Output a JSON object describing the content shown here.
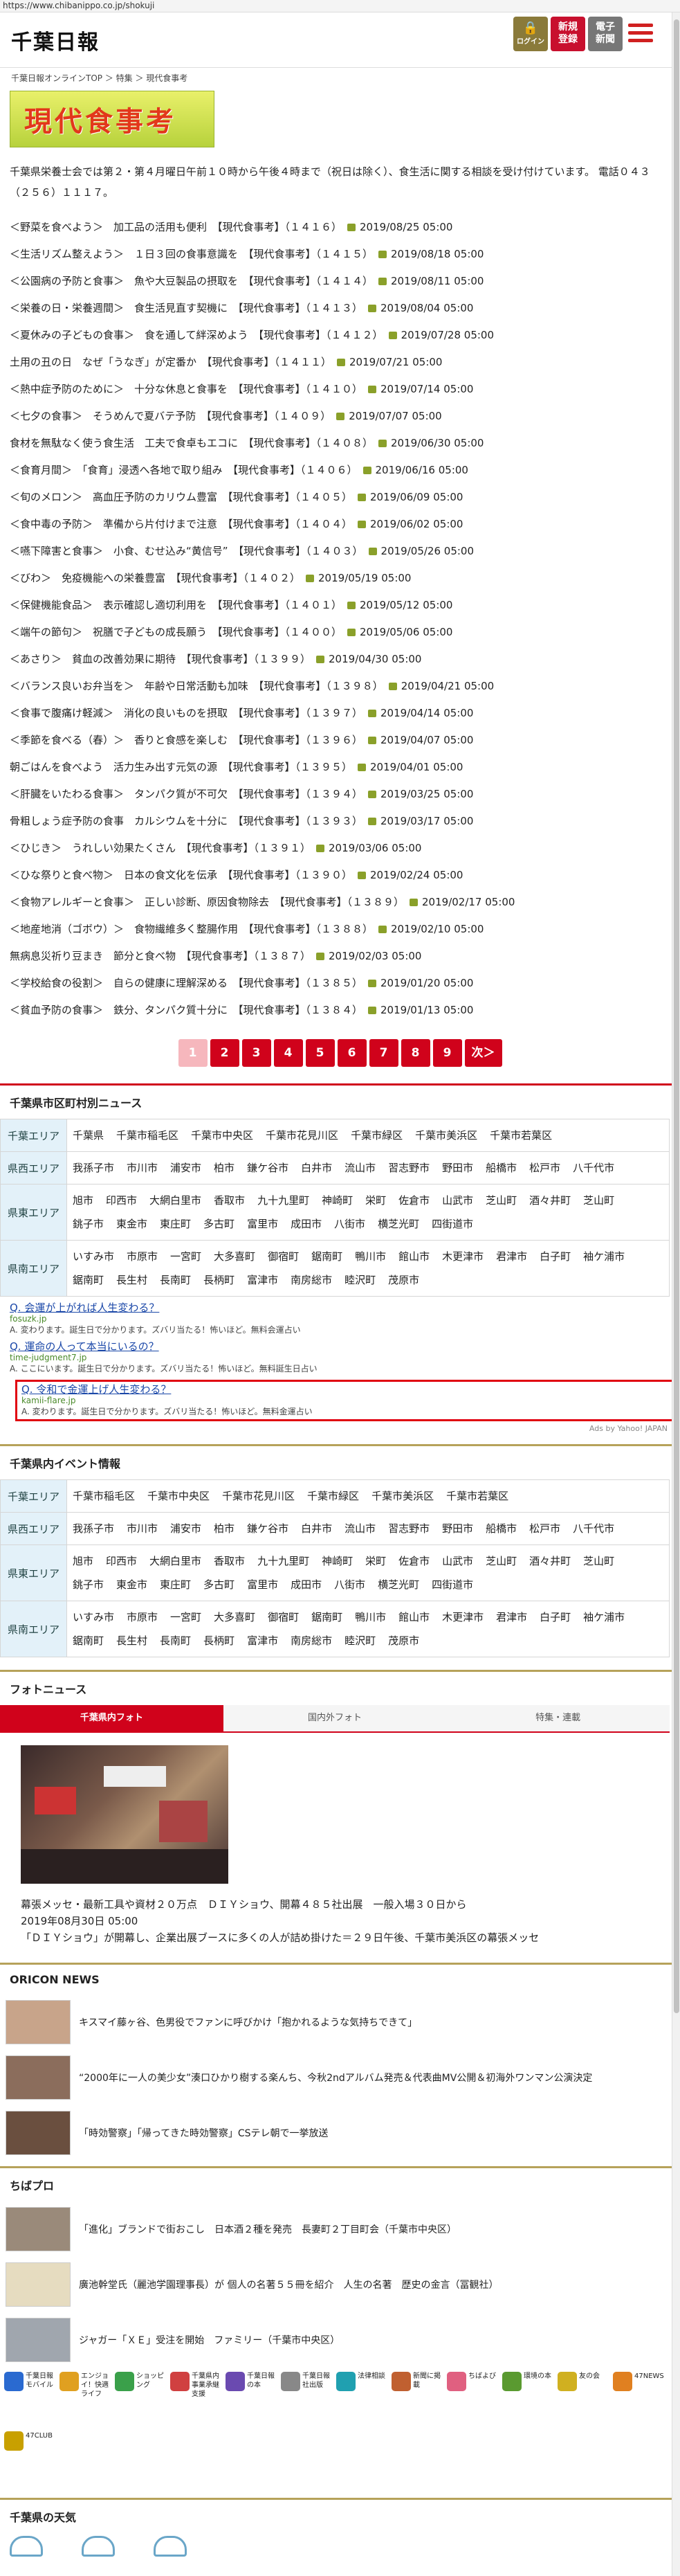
{
  "url": "https://www.chibanippo.co.jp/shokuji",
  "header": {
    "logo": "千葉日報",
    "login": "ログイン",
    "register1": "新規",
    "register2": "登録",
    "epaper1": "電子",
    "epaper2": "新聞"
  },
  "breadcrumb": "千葉日報オンラインTOP ＞ 特集 ＞ 現代食事考",
  "banner_title": "現代食事考",
  "intro": "千葉県栄養士会では第２・第４月曜日午前１０時から午後４時まで（祝日は除く）、食生活に関する相談を受け付けています。 電話０４３（２５６）１１１７。",
  "articles": [
    {
      "title": "＜野菜を食べよう＞　加工品の活用も便利　【現代食事考】（１４１６）",
      "date": "2019/08/25 05:00"
    },
    {
      "title": "＜生活リズム整えよう＞　１日３回の食事意識を　【現代食事考】（１４１５）",
      "date": "2019/08/18 05:00"
    },
    {
      "title": "＜公園病の予防と食事＞　魚や大豆製品の摂取を　【現代食事考】（１４１４）",
      "date": "2019/08/11 05:00"
    },
    {
      "title": "＜栄養の日・栄養週間＞　食生活見直す契機に　【現代食事考】（１４１３）",
      "date": "2019/08/04 05:00"
    },
    {
      "title": "＜夏休みの子どもの食事＞　食を通して絆深めよう　【現代食事考】（１４１２）",
      "date": "2019/07/28 05:00"
    },
    {
      "title": "土用の丑の日　なぜ「うなぎ」が定番か　【現代食事考】（１４１１）",
      "date": "2019/07/21 05:00"
    },
    {
      "title": "＜熱中症予防のために＞　十分な休息と食事を　【現代食事考】（１４１０）",
      "date": "2019/07/14 05:00"
    },
    {
      "title": "＜七夕の食事＞　そうめんで夏バテ予防　【現代食事考】（１４０９）",
      "date": "2019/07/07 05:00"
    },
    {
      "title": "食材を無駄なく使う食生活　工夫で食卓もエコに　【現代食事考】（１４０８）",
      "date": "2019/06/30 05:00"
    },
    {
      "title": "＜食育月間＞　「食育」浸透へ各地で取り組み　【現代食事考】（１４０６）",
      "date": "2019/06/16 05:00"
    },
    {
      "title": "＜旬のメロン＞　高血圧予防のカリウム豊富　【現代食事考】（１４０５）",
      "date": "2019/06/09 05:00"
    },
    {
      "title": "＜食中毒の予防＞　準備から片付けまで注意　【現代食事考】（１４０４）",
      "date": "2019/06/02 05:00"
    },
    {
      "title": "＜嚥下障害と食事＞　小食、むせ込み“黄信号”　【現代食事考】（１４０３）",
      "date": "2019/05/26 05:00"
    },
    {
      "title": "＜びわ＞　免疫機能への栄養豊富　【現代食事考】（１４０２）",
      "date": "2019/05/19 05:00"
    },
    {
      "title": "＜保健機能食品＞　表示確認し適切利用を　【現代食事考】（１４０１）",
      "date": "2019/05/12 05:00"
    },
    {
      "title": "＜端午の節句＞　祝膳で子どもの成長願う　【現代食事考】（１４００）",
      "date": "2019/05/06 05:00"
    },
    {
      "title": "＜あさり＞　貧血の改善効果に期待　【現代食事考】（１３９９）",
      "date": "2019/04/30 05:00"
    },
    {
      "title": "＜バランス良いお弁当を＞　年齢や日常活動も加味　【現代食事考】（１３９８）",
      "date": "2019/04/21 05:00"
    },
    {
      "title": "＜食事で腹痛け軽減＞　消化の良いものを摂取　【現代食事考】（１３９７）",
      "date": "2019/04/14 05:00"
    },
    {
      "title": "＜季節を食べる（春）＞　香りと食感を楽しむ　【現代食事考】（１３９６）",
      "date": "2019/04/07 05:00"
    },
    {
      "title": "朝ごはんを食べよう　活力生み出す元気の源　【現代食事考】（１３９５）",
      "date": "2019/04/01 05:00"
    },
    {
      "title": "＜肝臓をいたわる食事＞　タンパク質が不可欠　【現代食事考】（１３９４）",
      "date": "2019/03/25 05:00"
    },
    {
      "title": "骨粗しょう症予防の食事　カルシウムを十分に　【現代食事考】（１３９３）",
      "date": "2019/03/17 05:00"
    },
    {
      "title": "＜ひじき＞　うれしい効果たくさん　【現代食事考】（１３９１）",
      "date": "2019/03/06 05:00"
    },
    {
      "title": "＜ひな祭りと食べ物＞　日本の食文化を伝承　【現代食事考】（１３９０）",
      "date": "2019/02/24 05:00"
    },
    {
      "title": "＜食物アレルギーと食事＞　正しい診断、原因食物除去　【現代食事考】（１３８９）",
      "date": "2019/02/17 05:00"
    },
    {
      "title": "＜地産地消（ゴボウ）＞　食物繊維多く整腸作用　【現代食事考】（１３８８）",
      "date": "2019/02/10 05:00"
    },
    {
      "title": "無病息災祈り豆まき　節分と食べ物　【現代食事考】（１３８７）",
      "date": "2019/02/03 05:00"
    },
    {
      "title": "＜学校給食の役割＞　自らの健康に理解深める　【現代食事考】（１３８５）",
      "date": "2019/01/20 05:00"
    },
    {
      "title": "＜貧血予防の食事＞　鉄分、タンパク質十分に　【現代食事考】（１３８４）",
      "date": "2019/01/13 05:00"
    }
  ],
  "pager": {
    "pages": [
      "1",
      "2",
      "3",
      "4",
      "5",
      "6",
      "7",
      "8",
      "9"
    ],
    "next": "次＞",
    "current": "1"
  },
  "city_news": {
    "title": "千葉県市区町村別ニュース",
    "rows": [
      {
        "area": "千葉エリア",
        "cities": [
          "千葉県",
          "千葉市稲毛区",
          "千葉市中央区",
          "千葉市花見川区",
          "千葉市緑区",
          "千葉市美浜区",
          "千葉市若葉区"
        ]
      },
      {
        "area": "県西エリア",
        "cities": [
          "我孫子市",
          "市川市",
          "浦安市",
          "柏市",
          "鎌ケ谷市",
          "白井市",
          "流山市",
          "習志野市",
          "野田市",
          "船橋市",
          "松戸市",
          "八千代市"
        ]
      },
      {
        "area": "県東エリア",
        "cities": [
          "旭市",
          "印西市",
          "大網白里市",
          "香取市",
          "九十九里町",
          "神崎町",
          "栄町",
          "佐倉市",
          "山武市",
          "芝山町",
          "酒々井町",
          "芝山町",
          "銚子市",
          "東金市",
          "東庄町",
          "多古町",
          "富里市",
          "成田市",
          "八街市",
          "横芝光町",
          "四街道市"
        ]
      },
      {
        "area": "県南エリア",
        "cities": [
          "いすみ市",
          "市原市",
          "一宮町",
          "大多喜町",
          "御宿町",
          "鋸南町",
          "鴨川市",
          "館山市",
          "木更津市",
          "君津市",
          "白子町",
          "袖ケ浦市",
          "鋸南町",
          "長生村",
          "長南町",
          "長柄町",
          "富津市",
          "南房総市",
          "睦沢町",
          "茂原市"
        ]
      }
    ]
  },
  "ads": [
    {
      "title": "Q. 会運が上がれば人生変わる？",
      "url": "fosuzk.jp",
      "desc": "A. 変わります。誕生日で分かります。ズバリ当たる！怖いほど。無料会運占い"
    },
    {
      "title": "Q. 運命の人って本当にいるの？",
      "url": "time-judgment7.jp",
      "desc": "A. ここにいます。誕生日で分かります。ズバリ当たる！怖いほど。無料誕生日占い"
    },
    {
      "title": "Q. 令和で金運上げ人生変わる？",
      "url": "kamii-flare.jp",
      "desc": "A. 変わります。誕生日で分かります。ズバリ当たる！怖いほど。無料金運占い"
    }
  ],
  "ads_by": "Ads by Yahoo! JAPAN",
  "events": {
    "title": "千葉県内イベント情報",
    "rows": [
      {
        "area": "千葉エリア",
        "cities": [
          "千葉市稲毛区",
          "千葉市中央区",
          "千葉市花見川区",
          "千葉市緑区",
          "千葉市美浜区",
          "千葉市若葉区"
        ]
      },
      {
        "area": "県西エリア",
        "cities": [
          "我孫子市",
          "市川市",
          "浦安市",
          "柏市",
          "鎌ケ谷市",
          "白井市",
          "流山市",
          "習志野市",
          "野田市",
          "船橋市",
          "松戸市",
          "八千代市"
        ]
      },
      {
        "area": "県東エリア",
        "cities": [
          "旭市",
          "印西市",
          "大網白里市",
          "香取市",
          "九十九里町",
          "神崎町",
          "栄町",
          "佐倉市",
          "山武市",
          "芝山町",
          "酒々井町",
          "芝山町",
          "銚子市",
          "東金市",
          "東庄町",
          "多古町",
          "富里市",
          "成田市",
          "八街市",
          "横芝光町",
          "四街道市"
        ]
      },
      {
        "area": "県南エリア",
        "cities": [
          "いすみ市",
          "市原市",
          "一宮町",
          "大多喜町",
          "御宿町",
          "鋸南町",
          "鴨川市",
          "館山市",
          "木更津市",
          "君津市",
          "白子町",
          "袖ケ浦市",
          "鋸南町",
          "長生村",
          "長南町",
          "長柄町",
          "富津市",
          "南房総市",
          "睦沢町",
          "茂原市"
        ]
      }
    ]
  },
  "photo_news": {
    "title": "フォトニュース",
    "tabs": [
      "千葉県内フォト",
      "国内外フォト",
      "特集・連載"
    ],
    "caption": "幕張メッセ・最新工具や資材２０万点　ＤＩＹショウ、開幕４８５社出展　一般入場３０日から",
    "date": "2019年08月30日 05:00",
    "body": "「ＤＩＹショウ」が開幕し、企業出展ブースに多くの人が詰め掛けた＝２９日午後、千葉市美浜区の幕張メッセ"
  },
  "oricon": {
    "title": "ORICON NEWS",
    "items": [
      "キスマイ藤ヶ谷、色男役でファンに呼びかけ「抱かれるような気持ちできて」",
      "“2000年に一人の美少女”湊口ひかり樹する楽んち、今秋2ndアルバム発売＆代表曲MV公開＆初海外ワンマン公演決定",
      "「時効警察」「帰ってきた時効警察」CSテレ朝で一挙放送"
    ]
  },
  "chibapro": {
    "title": "ちばプロ",
    "items": [
      "「進化」ブランドで街おこし　日本酒２種を発売　長妻町２丁目町会（千葉市中央区）",
      "廣池幹堂氏（麗池学園理事長）が 個人の名著５５冊を紹介　人生の名著　歴史の金言（冨観社）",
      "ジャガー「ＸＥ」受注を開始　ファミリー（千葉市中央区）"
    ]
  },
  "services": [
    "千葉日報モバイル",
    "エンジョイ！快適ライフ",
    "ショッピング",
    "千葉県内事業承継支援",
    "千葉日報の本",
    "千葉日報社出版",
    "法律相談",
    "新聞に掲載",
    "ちばよび",
    "環境の本",
    "友の会",
    "47NEWS",
    "47CLUB"
  ],
  "weather_title": "千葉県の天気"
}
